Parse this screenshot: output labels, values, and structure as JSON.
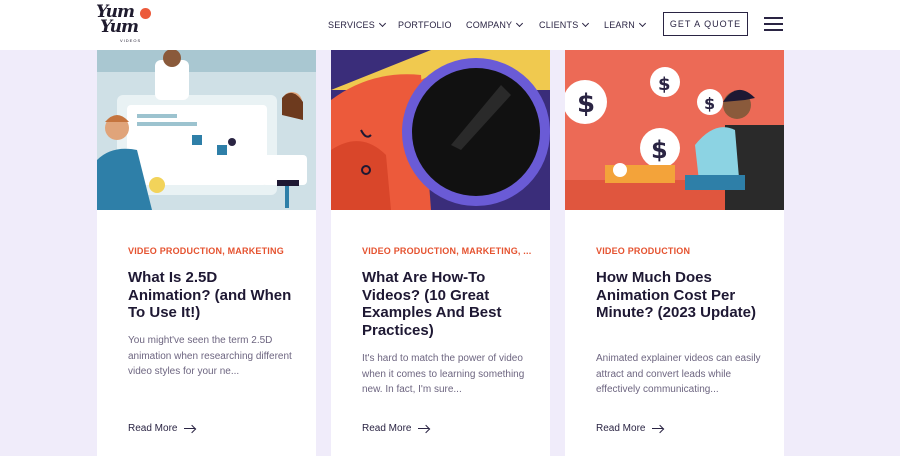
{
  "brand": {
    "logo_line1": "Yum",
    "logo_line2": "Yum",
    "logo_tagline": "VIDEOS",
    "accent": "#e5522f",
    "ink": "#2a2443",
    "page_bg": "#f0ecfa"
  },
  "nav": {
    "items": [
      {
        "label": "SERVICES",
        "has_dropdown": true
      },
      {
        "label": "PORTFOLIO",
        "has_dropdown": false
      },
      {
        "label": "COMPANY",
        "has_dropdown": true
      },
      {
        "label": "CLIENTS",
        "has_dropdown": true
      },
      {
        "label": "LEARN",
        "has_dropdown": true
      }
    ],
    "cta_label": "GET A QUOTE",
    "menu_icon": "hamburger-menu-icon"
  },
  "cards": [
    {
      "category": "VIDEO PRODUCTION, MARKETING",
      "title": "What Is 2.5D Animation? (and When To Use It!)",
      "excerpt": "You might've seen the term 2.5D animation when researching different video styles for your ne...",
      "read_more": "Read More",
      "image": "animation-team-illustration"
    },
    {
      "category": "VIDEO PRODUCTION, MARKETING, ...",
      "title": "What Are How-To Videos? (10 Great Examples And Best Practices)",
      "excerpt": "It's hard to match the power of video when it comes to learning something new. In fact, I'm sure...",
      "read_more": "Read More",
      "image": "magnifying-glass-illustration"
    },
    {
      "category": "VIDEO PRODUCTION",
      "title": "How Much Does Animation Cost Per Minute? (2023 Update)",
      "excerpt": "Animated explainer videos can easily attract and convert leads while effectively communicating...",
      "read_more": "Read More",
      "image": "animation-cost-illustration"
    }
  ]
}
